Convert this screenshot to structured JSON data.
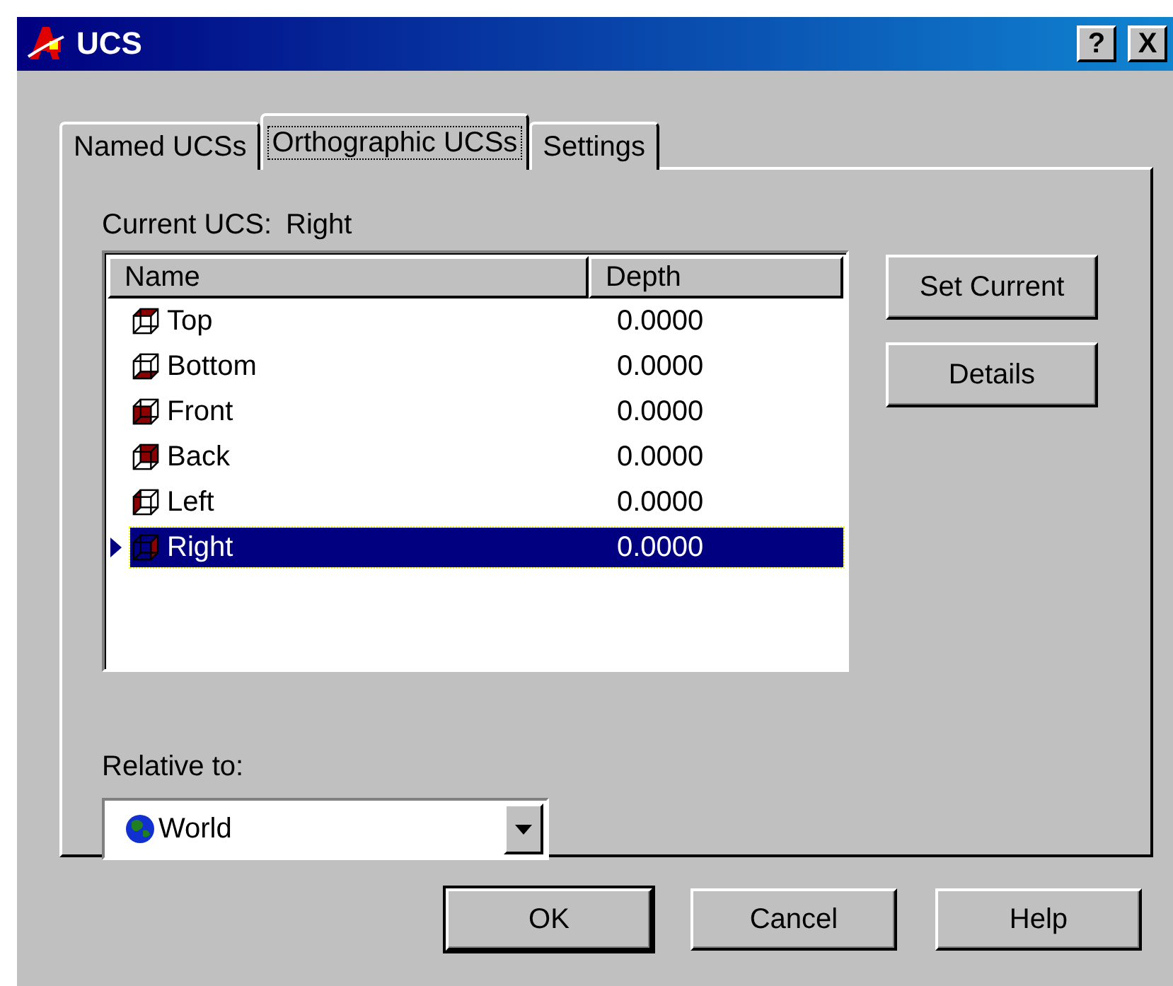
{
  "window": {
    "title": "UCS",
    "title_buttons": [
      "?",
      "X"
    ]
  },
  "tabs": [
    {
      "label": "Named UCSs",
      "selected": false
    },
    {
      "label": "Orthographic UCSs",
      "selected": true
    },
    {
      "label": "Settings",
      "selected": false
    }
  ],
  "current_ucs": {
    "label": "Current UCS:",
    "value": "Right"
  },
  "list": {
    "columns": [
      "Name",
      "Depth"
    ],
    "rows": [
      {
        "name": "Top",
        "depth": "0.0000",
        "selected": false,
        "current": false
      },
      {
        "name": "Bottom",
        "depth": "0.0000",
        "selected": false,
        "current": false
      },
      {
        "name": "Front",
        "depth": "0.0000",
        "selected": false,
        "current": false
      },
      {
        "name": "Back",
        "depth": "0.0000",
        "selected": false,
        "current": false
      },
      {
        "name": "Left",
        "depth": "0.0000",
        "selected": false,
        "current": false
      },
      {
        "name": "Right",
        "depth": "0.0000",
        "selected": true,
        "current": true
      }
    ]
  },
  "side_buttons": [
    "Set Current",
    "Details"
  ],
  "relative_to": {
    "label": "Relative to:",
    "value": "World"
  },
  "buttons": [
    {
      "label": "OK",
      "default": true
    },
    {
      "label": "Cancel",
      "default": false
    },
    {
      "label": "Help",
      "default": false
    }
  ]
}
